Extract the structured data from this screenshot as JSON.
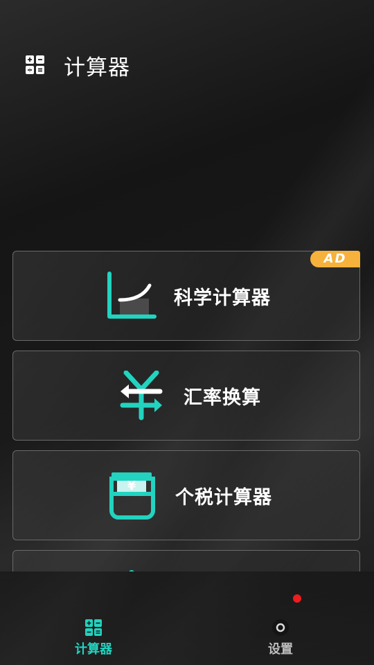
{
  "header": {
    "title": "计算器",
    "icon": "calculator-grid-icon"
  },
  "cards": [
    {
      "label": "科学计算器",
      "icon": "curve-graph-icon",
      "badge": "AD"
    },
    {
      "label": "汇率换算",
      "icon": "currency-exchange-icon"
    },
    {
      "label": "个税计算器",
      "icon": "tax-wallet-icon"
    }
  ],
  "tabbar": {
    "tabs": [
      {
        "label": "计算器",
        "icon": "calculator-grid-icon",
        "active": true
      },
      {
        "label": "设置",
        "icon": "settings-dot-icon",
        "active": false
      }
    ]
  },
  "colors": {
    "accent": "#22d3c0",
    "badge": "#f6b23c",
    "notification": "#ee1c1c"
  }
}
